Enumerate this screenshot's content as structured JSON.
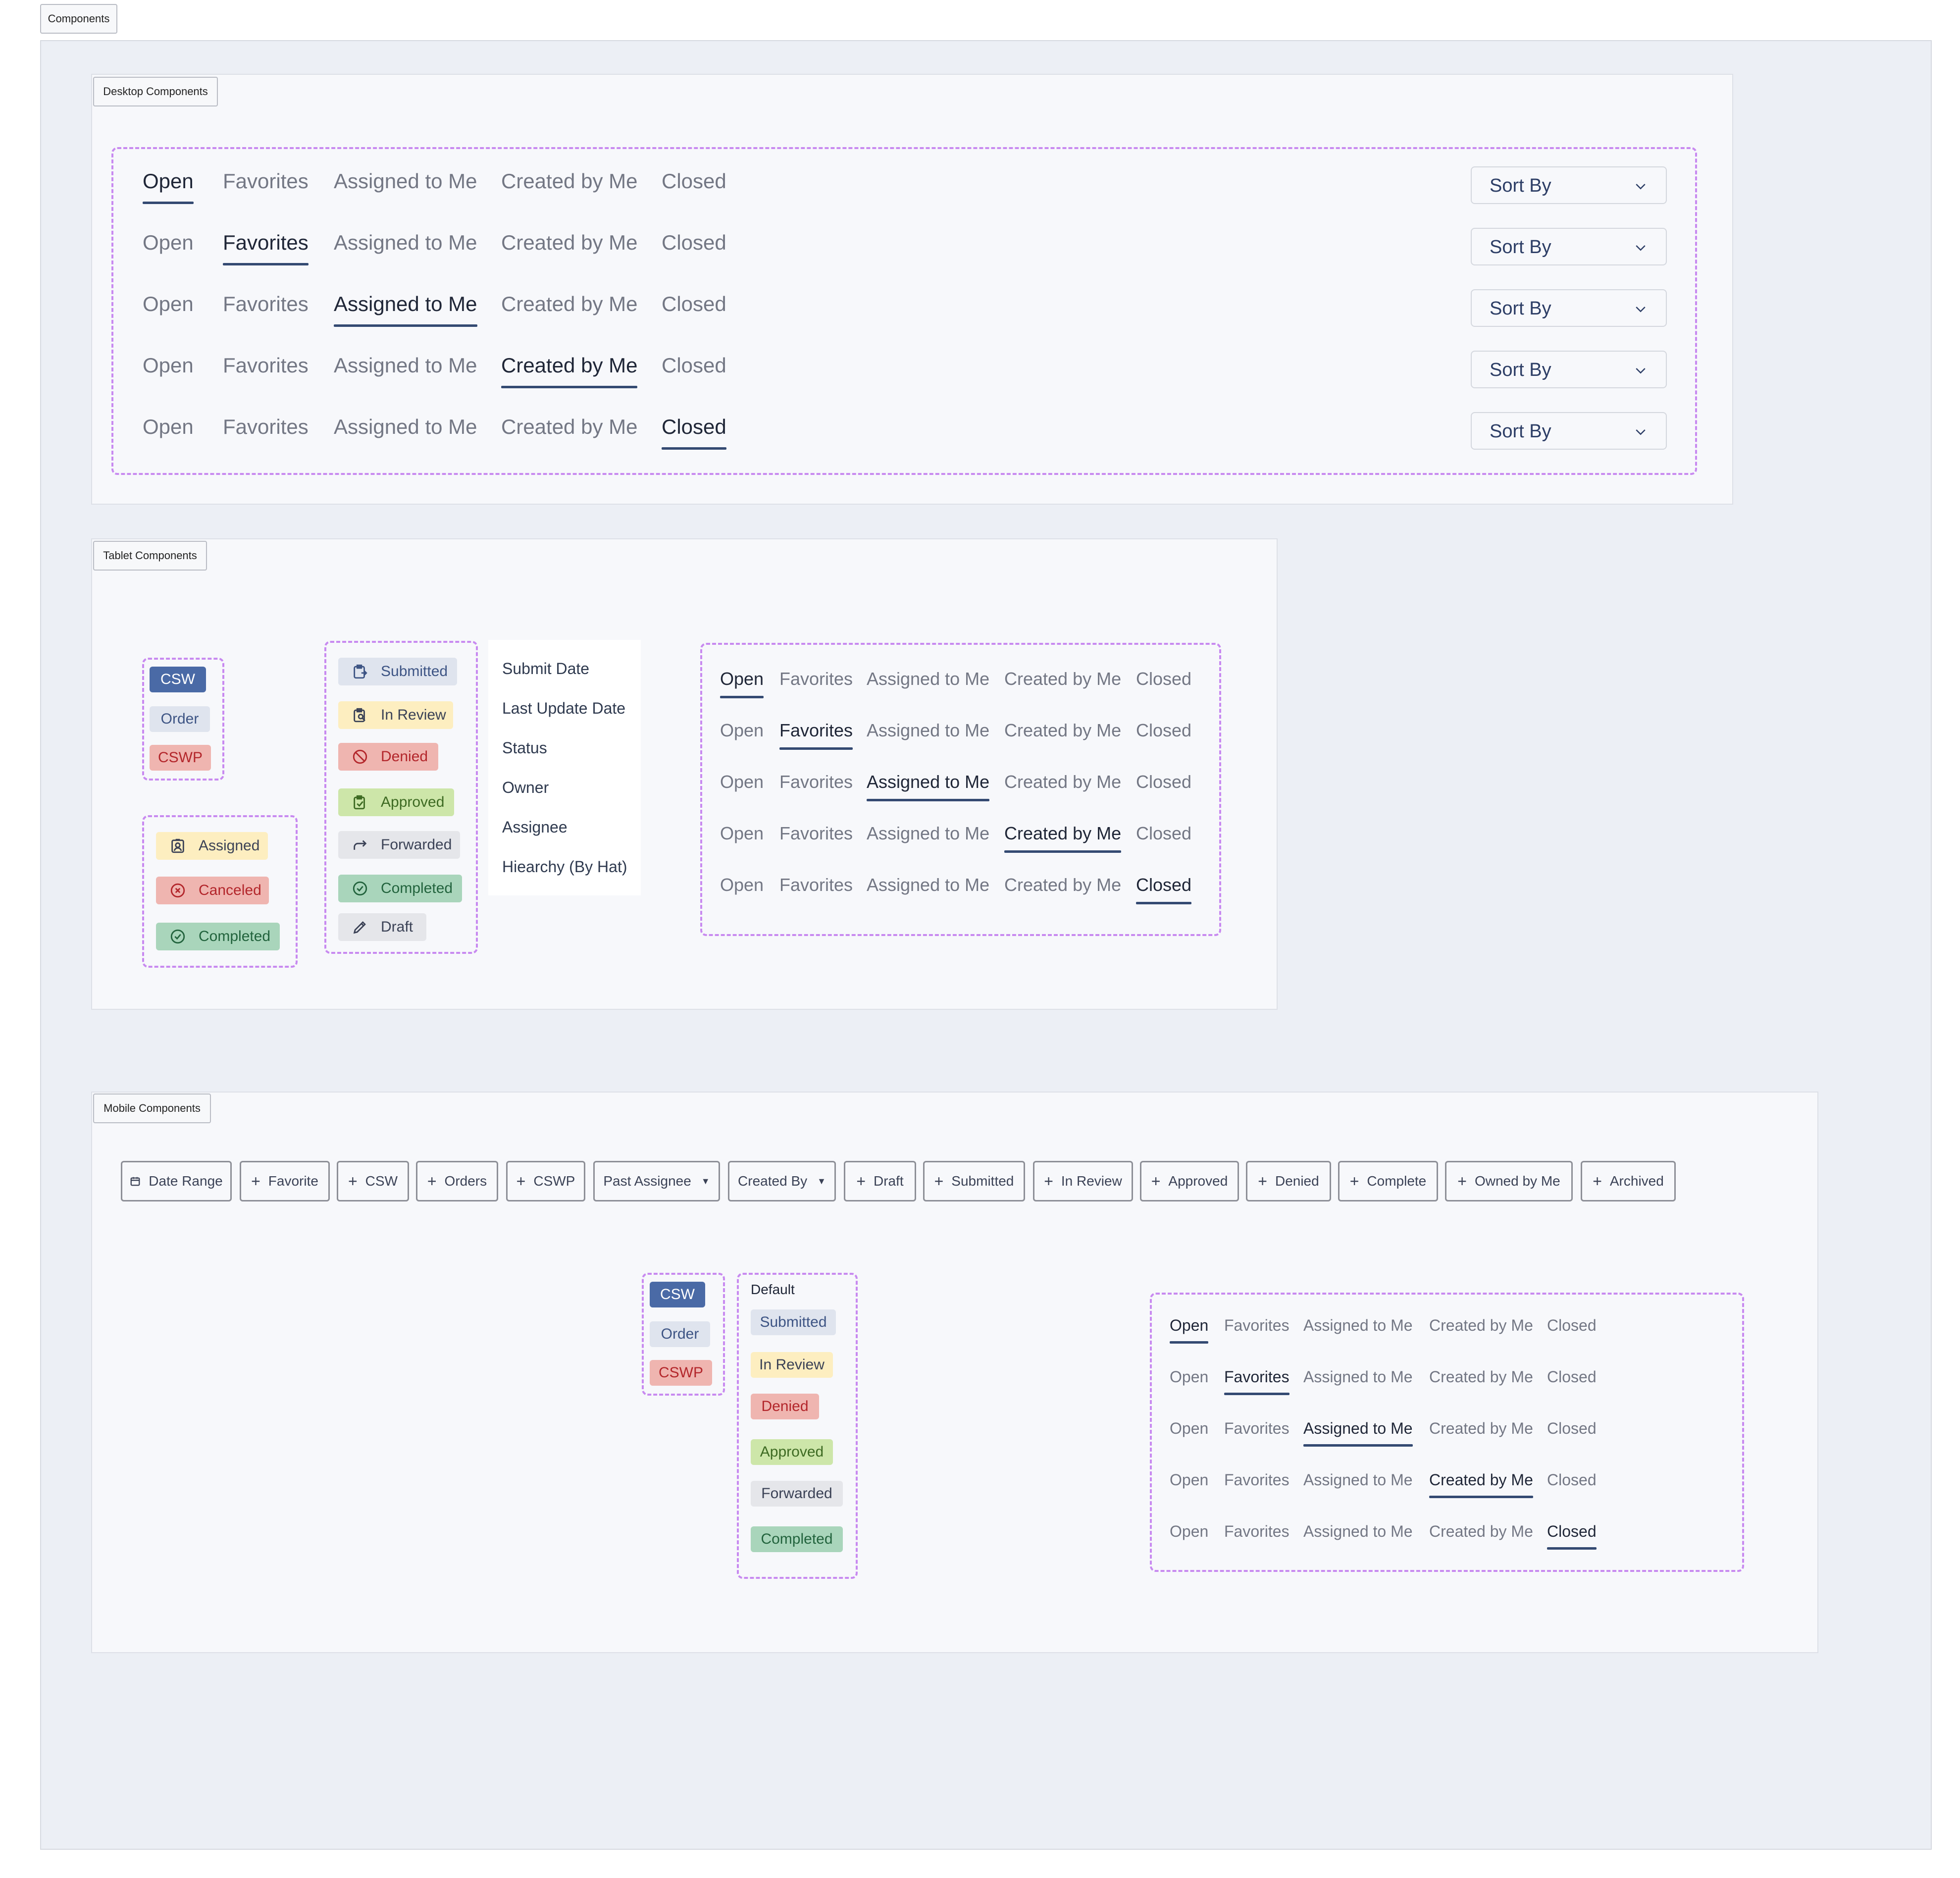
{
  "frames": {
    "components": "Components",
    "desktop": "Desktop Components",
    "tablet": "Tablet Components",
    "mobile": "Mobile Components"
  },
  "tabs": [
    "Open",
    "Favorites",
    "Assigned to Me",
    "Created by Me",
    "Closed"
  ],
  "sort": {
    "label": "Sort By"
  },
  "type_badges": [
    "CSW",
    "Order",
    "CSWP"
  ],
  "assignment_badges": [
    "Assigned",
    "Canceled",
    "Completed"
  ],
  "status_badges": [
    "Submitted",
    "In Review",
    "Denied",
    "Approved",
    "Forwarded",
    "Completed",
    "Draft"
  ],
  "sort_options": [
    "Submit Date",
    "Last Update Date",
    "Status",
    "Owner",
    "Assignee",
    "Hiearchy (By Hat)"
  ],
  "filter_chips": {
    "date_range": "Date Range",
    "favorite": "Favorite",
    "csw": "CSW",
    "orders": "Orders",
    "cswp": "CSWP",
    "past_assignee": "Past Assignee",
    "created_by": "Created By",
    "draft": "Draft",
    "submitted": "Submitted",
    "in_review": "In Review",
    "approved": "Approved",
    "denied": "Denied",
    "complete": "Complete",
    "owned_by_me": "Owned by Me",
    "archived": "Archived"
  },
  "mobile_status": {
    "heading": "Default",
    "items": [
      "Submitted",
      "In Review",
      "Denied",
      "Approved",
      "Forwarded",
      "Completed"
    ]
  },
  "colors": {
    "accent": "#344a72",
    "dashed_border": "#c88af0",
    "csw": "#4a6aa6",
    "cswp": "#efb5b0",
    "approved": "#cde6a9",
    "completed": "#a9d5bb",
    "in_review": "#fdeec0"
  }
}
